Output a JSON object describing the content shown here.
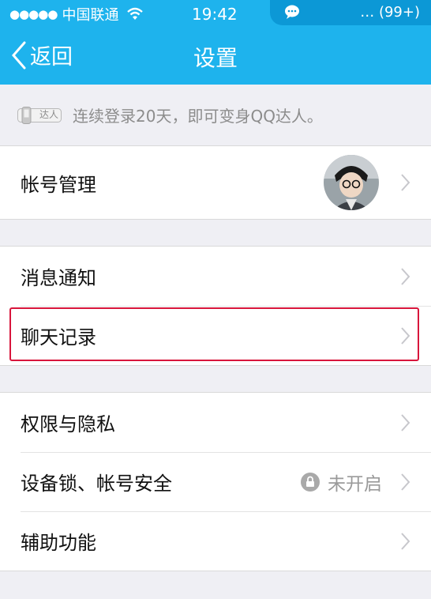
{
  "status_bar": {
    "carrier": "中国联通",
    "time": "19:42",
    "notification_count": "… (99+)"
  },
  "nav": {
    "back_label": "返回",
    "title": "设置"
  },
  "banner": {
    "badge_text": "达人",
    "text": "连续登录20天，即可变身QQ达人。"
  },
  "groups": [
    {
      "rows": [
        {
          "label": "帐号管理"
        }
      ]
    },
    {
      "rows": [
        {
          "label": "消息通知"
        },
        {
          "label": "聊天记录",
          "highlighted": true
        }
      ]
    },
    {
      "rows": [
        {
          "label": "权限与隐私"
        },
        {
          "label": "设备锁、帐号安全",
          "value": "未开启"
        },
        {
          "label": "辅助功能"
        }
      ]
    }
  ],
  "colors": {
    "header": "#1eb3ed",
    "background": "#efeff4",
    "highlight": "#d8163c"
  }
}
